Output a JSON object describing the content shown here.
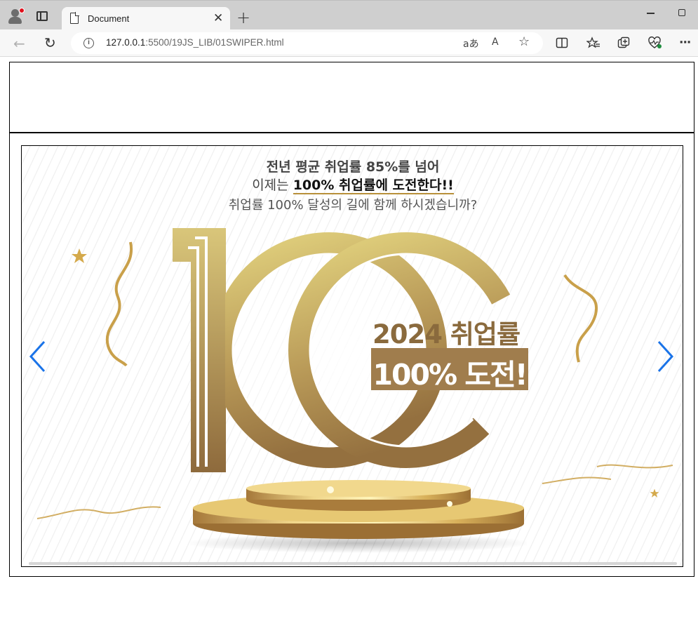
{
  "browser": {
    "tab_title": "Document",
    "tab_close": "✕",
    "new_tab": "+",
    "url_host": "127.0.0.1",
    "url_rest": ":5500/19JS_LIB/01SWIPER.html",
    "info_glyph": "i",
    "translate_glyph": "aあ",
    "read_aloud_glyph": "A",
    "favorite_glyph": "☆",
    "back_glyph": "←",
    "reload_glyph": "↻",
    "more_glyph": "···"
  },
  "banner": {
    "headline_1": "전년 평균 취업률 85%를 넘어",
    "headline_2_prefix": "이제는 ",
    "headline_2_strong": "100% 취업률에 도전한다!!",
    "headline_3": "취업률 100% 달성의 길에 함께 하시겠습니까?",
    "promo_year": "2024 취업률",
    "promo_challenge": "100% 도전!",
    "big_number": "100"
  },
  "colors": {
    "gold_light": "#e3d27d",
    "gold_dark": "#9a7240",
    "arrow_blue": "#1a73e8",
    "promo_box": "#a07d4d"
  },
  "icons": {
    "prev": "chevron-left-icon",
    "next": "chevron-right-icon"
  }
}
